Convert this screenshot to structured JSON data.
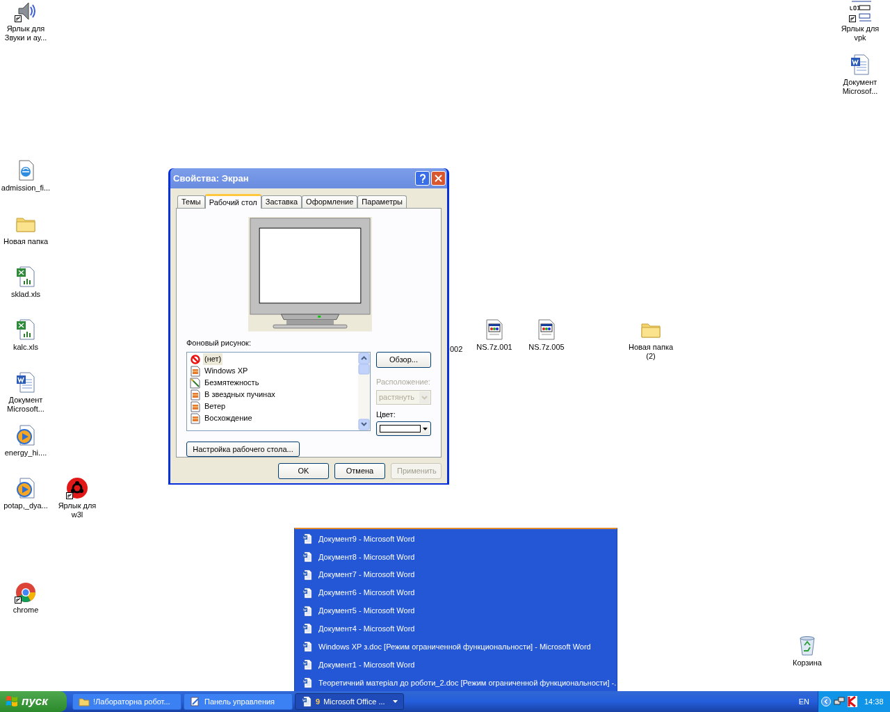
{
  "desktop_icons": [
    {
      "label_lines": [
        "Ярлык для",
        "Звуки и ау..."
      ],
      "kind": "speaker",
      "shortcut": true
    },
    {
      "label_lines": [
        "admission_fi..."
      ],
      "kind": "web-doc",
      "shortcut": false
    },
    {
      "label_lines": [
        "Новая папка"
      ],
      "kind": "folder",
      "shortcut": false
    },
    {
      "label_lines": [
        "sklad.xls"
      ],
      "kind": "excel",
      "shortcut": false
    },
    {
      "label_lines": [
        "kalc.xls"
      ],
      "kind": "excel",
      "shortcut": false
    },
    {
      "label_lines": [
        "Документ",
        "Microsoft..."
      ],
      "kind": "word",
      "shortcut": false
    },
    {
      "label_lines": [
        "energy_hi...."
      ],
      "kind": "media",
      "shortcut": false
    },
    {
      "label_lines": [
        "potap,_dya..."
      ],
      "kind": "media",
      "shortcut": false
    },
    {
      "label_lines": [
        "Ярлык для",
        "w3l"
      ],
      "kind": "biohazard",
      "shortcut": true
    },
    {
      "label_lines": [
        "chrome"
      ],
      "kind": "chrome",
      "shortcut": true
    },
    {
      "label_lines": [
        "002"
      ],
      "kind": "hidden"
    },
    {
      "label_lines": [
        "NS.7z.001"
      ],
      "kind": "program",
      "shortcut": false
    },
    {
      "label_lines": [
        "NS.7z.005"
      ],
      "kind": "program",
      "shortcut": false
    },
    {
      "label_lines": [
        "Новая папка",
        "(2)"
      ],
      "kind": "folder",
      "shortcut": false
    },
    {
      "label_lines": [
        "Ярлык для",
        "vpk"
      ],
      "kind": "diagram",
      "shortcut": true
    },
    {
      "label_lines": [
        "Документ",
        "Microsof..."
      ],
      "kind": "word",
      "shortcut": false
    },
    {
      "label_lines": [
        "Корзина"
      ],
      "kind": "recycle",
      "shortcut": false
    }
  ],
  "dialog": {
    "title": "Свойства: Экран",
    "tabs": [
      {
        "label": "Темы",
        "selected": false
      },
      {
        "label": "Рабочий стол",
        "selected": true
      },
      {
        "label": "Заставка",
        "selected": false
      },
      {
        "label": "Оформление",
        "selected": false
      },
      {
        "label": "Параметры",
        "selected": false
      }
    ],
    "background_label": "Фоновый рисунок:",
    "wallpapers": [
      {
        "label": "(нет)",
        "kind": "none",
        "selected": true
      },
      {
        "label": "Windows XP",
        "kind": "image",
        "selected": false
      },
      {
        "label": "Безмятежность",
        "kind": "drawing",
        "selected": false
      },
      {
        "label": "В звездных пучинах",
        "kind": "image",
        "selected": false
      },
      {
        "label": "Ветер",
        "kind": "image",
        "selected": false
      },
      {
        "label": "Восхождение",
        "kind": "image",
        "selected": false
      }
    ],
    "browse_button": "Обзор...",
    "position_label": "Расположение:",
    "position_value": "растянуть",
    "position_disabled": true,
    "color_label": "Цвет:",
    "customize_button": "Настройка рабочего стола...",
    "buttons": [
      {
        "label": "OK",
        "disabled": false
      },
      {
        "label": "Отмена",
        "disabled": false
      },
      {
        "label": "Применить",
        "disabled": true
      }
    ]
  },
  "group_menu": {
    "items": [
      "Документ9 - Microsoft Word",
      "Документ8 - Microsoft Word",
      "Документ7 - Microsoft Word",
      "Документ6 - Microsoft Word",
      "Документ5 - Microsoft Word",
      "Документ4 - Microsoft Word",
      "Windows XP  з.doc [Режим ограниченной функциональности] - Microsoft Word",
      "Документ1 - Microsoft Word",
      "Теоретичний матеріал до роботи_2.doc [Режим ограниченной функциональности] -."
    ]
  },
  "taskbar": {
    "start": "пуск",
    "tasks": [
      {
        "label": "!Лабораторна робот...",
        "kind": "folder",
        "selected": false
      },
      {
        "label": "Панель управления",
        "kind": "control-panel",
        "selected": false
      },
      {
        "label": "Microsoft Office ...",
        "kind": "word",
        "selected": true,
        "count": "9"
      }
    ],
    "language": "EN",
    "clock": "14:38"
  }
}
